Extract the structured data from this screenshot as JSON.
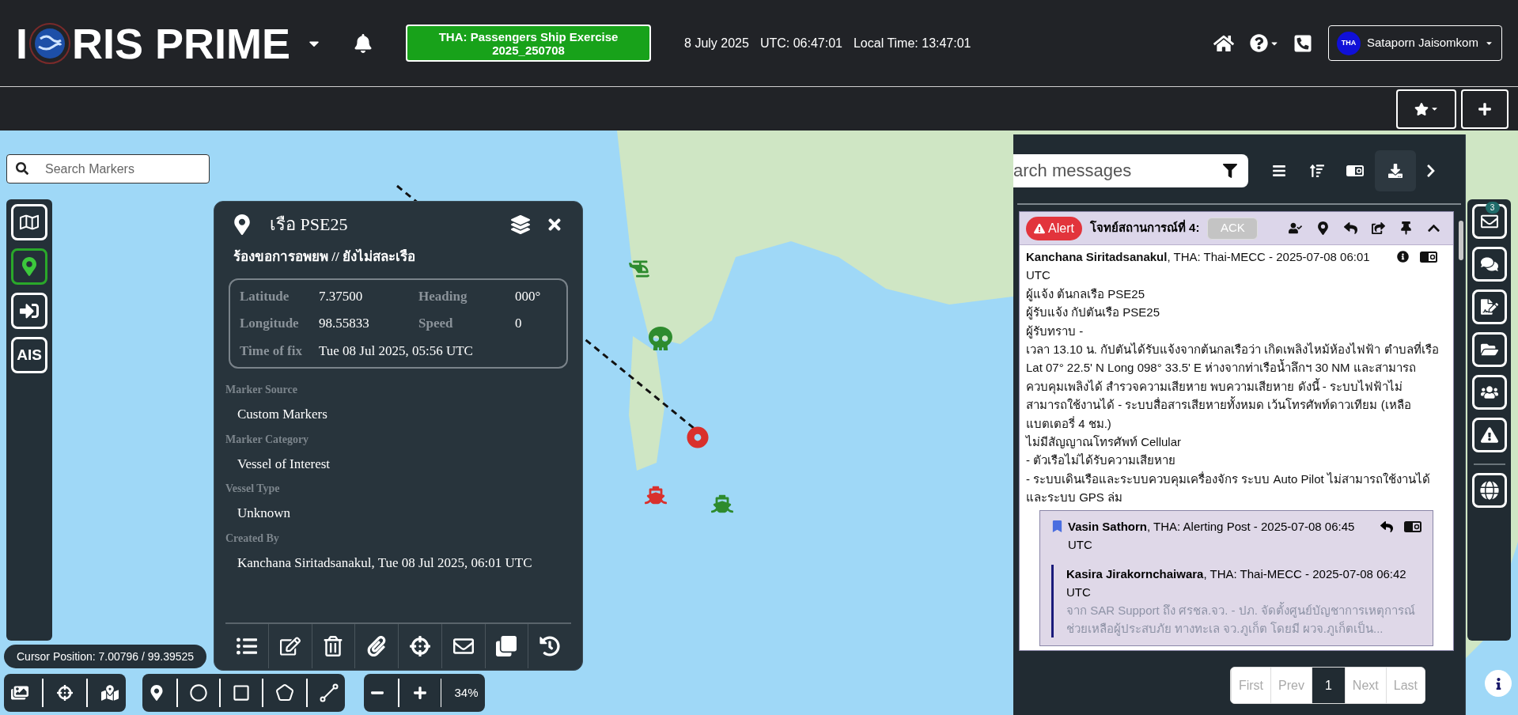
{
  "header": {
    "logo_start": "I",
    "logo_end": "RIS PRIME",
    "exercise": "THA: Passengers Ship Exercise 2025_250708",
    "date": "8 July 2025",
    "utc": "UTC: 06:47:01",
    "local_time": "Local Time: 13:47:01",
    "user_initials": "THA",
    "user_name": "Sataporn Jaisomkom"
  },
  "map_search": {
    "placeholder": "Search Markers"
  },
  "sidebar": {
    "items": [
      {
        "kind": "icon",
        "selected": false
      },
      {
        "kind": "icon",
        "selected": true
      },
      {
        "kind": "icon",
        "selected": false
      },
      {
        "kind": "text",
        "label": "AIS",
        "selected": false
      }
    ]
  },
  "popup": {
    "title": "เรือ PSE25",
    "subtitle": "ร้องขอการอพยพ // ยังไม่สละเรือ",
    "position": [
      {
        "label": "Latitude",
        "value": "7.37500",
        "label2": "Heading",
        "value2": "000°"
      },
      {
        "label": "Longitude",
        "value": "98.55833",
        "label2": "Speed",
        "value2": "0"
      }
    ],
    "time_of_fix": {
      "label": "Time of fix",
      "value": "Tue 08 Jul 2025, 05:56 UTC"
    },
    "details": [
      {
        "label": "Marker Source",
        "value": "Custom Markers"
      },
      {
        "label": "Marker Category",
        "value": "Vessel of Interest"
      },
      {
        "label": "Vessel Type",
        "value": "Unknown"
      },
      {
        "label": "Created By",
        "value": "Kanchana Siritadsanakul, Tue 08 Jul 2025, 06:01 UTC"
      }
    ]
  },
  "cursor_position": "Cursor Position: 7.00796 / 99.39525",
  "zoom_level": "34%",
  "messages": {
    "search_placeholder": "arch messages",
    "message": {
      "badge": "Alert",
      "title": "โจทย์สถานการณ์ที่ 4:",
      "ack": "ACK",
      "header": "**Kanchana Siritadsanakul**, THA: Thai-MECC - 2025-07-08 06:01 UTC",
      "body": [
        "ผู้แจ้ง ต้นกลเรือ PSE25",
        "ผู้รับแจ้ง กัปตันเรือ PSE25",
        "ผู้รับทราบ -",
        "เวลา 13.10 น. กัปตันได้รับแจ้งจากต้นกลเรือว่า เกิดเพลิงไหม้ห้องไฟฟ้า ตำบลที่เรือ Lat 07° 22.5' N Long 098° 33.5' E ห่างจากท่าเรือน้ำลึกฯ 30 NM และสามารถควบคุมเพลิงได้ สำรวจความเสียหาย พบความเสียหาย ดังนี้ - ระบบไฟฟ้าไม่สามารถใช้งานได้ - ระบบสื่อสารเสียหายทั้งหมด เว้นโทรศัพท์ดาวเทียม (เหลือแบตเตอรี่ 4 ชม.)",
        "ไม่มีสัญญาณโทรศัพท์ Cellular",
        "- ตัวเรือไม่ได้รับความเสียหาย",
        "- ระบบเดินเรือและระบบควบคุมเครื่องจักร ระบบ Auto Pilot ไม่สามารถใช้งานได้ และระบบ GPS ล่ม"
      ],
      "reply": {
        "header": "**Vasin Sathorn**, THA: Alerting Post - 2025-07-08 06:45 UTC",
        "quote_header": "**Kasira Jirakornchaiwara**, THA: Thai-MECC - 2025-07-08 06:42 UTC",
        "quote_text": "จาก SAR Support ถึง ศรชล.จว. - ปภ. จัดตั้งศูนย์บัญชาการเหตุการณ์ ช่วยเหลือผู้ประสบภัย ทางทะเล จว.ภูเก็ต โดยมี ผวจ.ภูเก็ตเป็น..."
      }
    },
    "pagination": [
      {
        "label": "First",
        "selected": false,
        "disabled": true
      },
      {
        "label": "Prev",
        "selected": false,
        "disabled": true
      },
      {
        "label": "1",
        "selected": true,
        "disabled": false
      },
      {
        "label": "Next",
        "selected": false,
        "disabled": true
      },
      {
        "label": "Last",
        "selected": false,
        "disabled": true
      }
    ]
  },
  "right_sidebar": {
    "unread_count": "3"
  }
}
